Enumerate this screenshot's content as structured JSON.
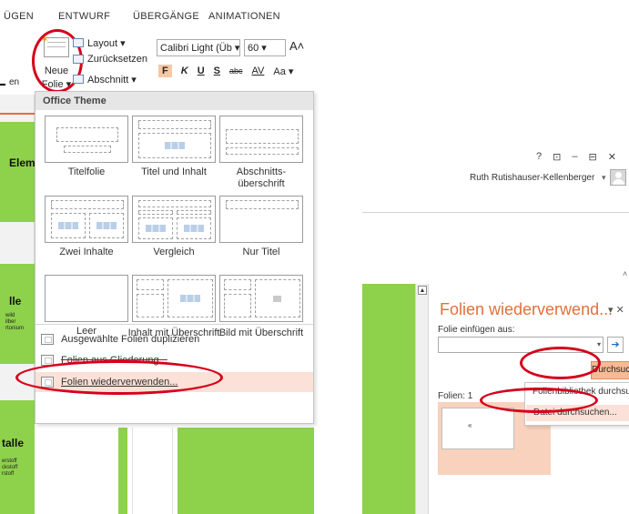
{
  "left": {
    "ribbon_tabs": [
      "ÜGEN",
      "ENTWURF",
      "ÜBERGÄNGE",
      "ANIMATIONEN"
    ],
    "neue_folie": {
      "line1": "Neue",
      "line2": "Folie ▾"
    },
    "slide_buttons": {
      "layout": "Layout ▾",
      "reset": "Zurücksetzen",
      "section": "Abschnitt ▾"
    },
    "font": {
      "name": "Calibri Light (Üb ▾",
      "size": "60 ▾",
      "grow": "A˄"
    },
    "format_buttons": [
      "F",
      "K",
      "U",
      "S",
      "abc",
      "AV",
      "Aa ▾"
    ],
    "group_label_stub": "en",
    "gallery_title": "Office Theme",
    "layouts": [
      {
        "label": "Titelfolie"
      },
      {
        "label": "Titel und Inhalt"
      },
      {
        "label": "Abschnitts-überschrift"
      },
      {
        "label": "Zwei Inhalte"
      },
      {
        "label": "Vergleich"
      },
      {
        "label": "Nur Titel"
      },
      {
        "label": "Leer"
      },
      {
        "label": "Inhalt mit Überschrift"
      },
      {
        "label": "Bild mit Überschrift"
      }
    ],
    "menu_items": [
      {
        "label": "Ausgewählte Folien duplizieren"
      },
      {
        "label": "Folien aus Gliederung..."
      },
      {
        "label": "Folien wiederverwenden..."
      }
    ],
    "thumbnails": [
      {
        "title": "Elem",
        "sub": ""
      },
      {
        "title": "lle",
        "sub": "wild\nilber\nrtonium"
      },
      {
        "title": "talle",
        "sub": "erstoff\nckstoff\nrstoff"
      }
    ]
  },
  "right": {
    "window_controls": [
      "?",
      "⊡",
      "–",
      "⊟",
      "✕"
    ],
    "user_name": "Ruth Rutishauser-Kellenberger",
    "user_arrow": "▾",
    "pane_title": "Folien wiederverwend...",
    "pane_controls": "▾ ✕",
    "insert_from_label": "Folie einfügen aus:",
    "input_value": "",
    "input_dropdown": "▾",
    "go_arrow": "➔",
    "browse_button": "Durchsuchen ▾",
    "slides_label": "Folien: 1",
    "dropdown_items": [
      "Folienbibliothek durchsuchen...",
      "Datei durchsuchen..."
    ],
    "scroll_up": "▲",
    "caret": "˄"
  }
}
